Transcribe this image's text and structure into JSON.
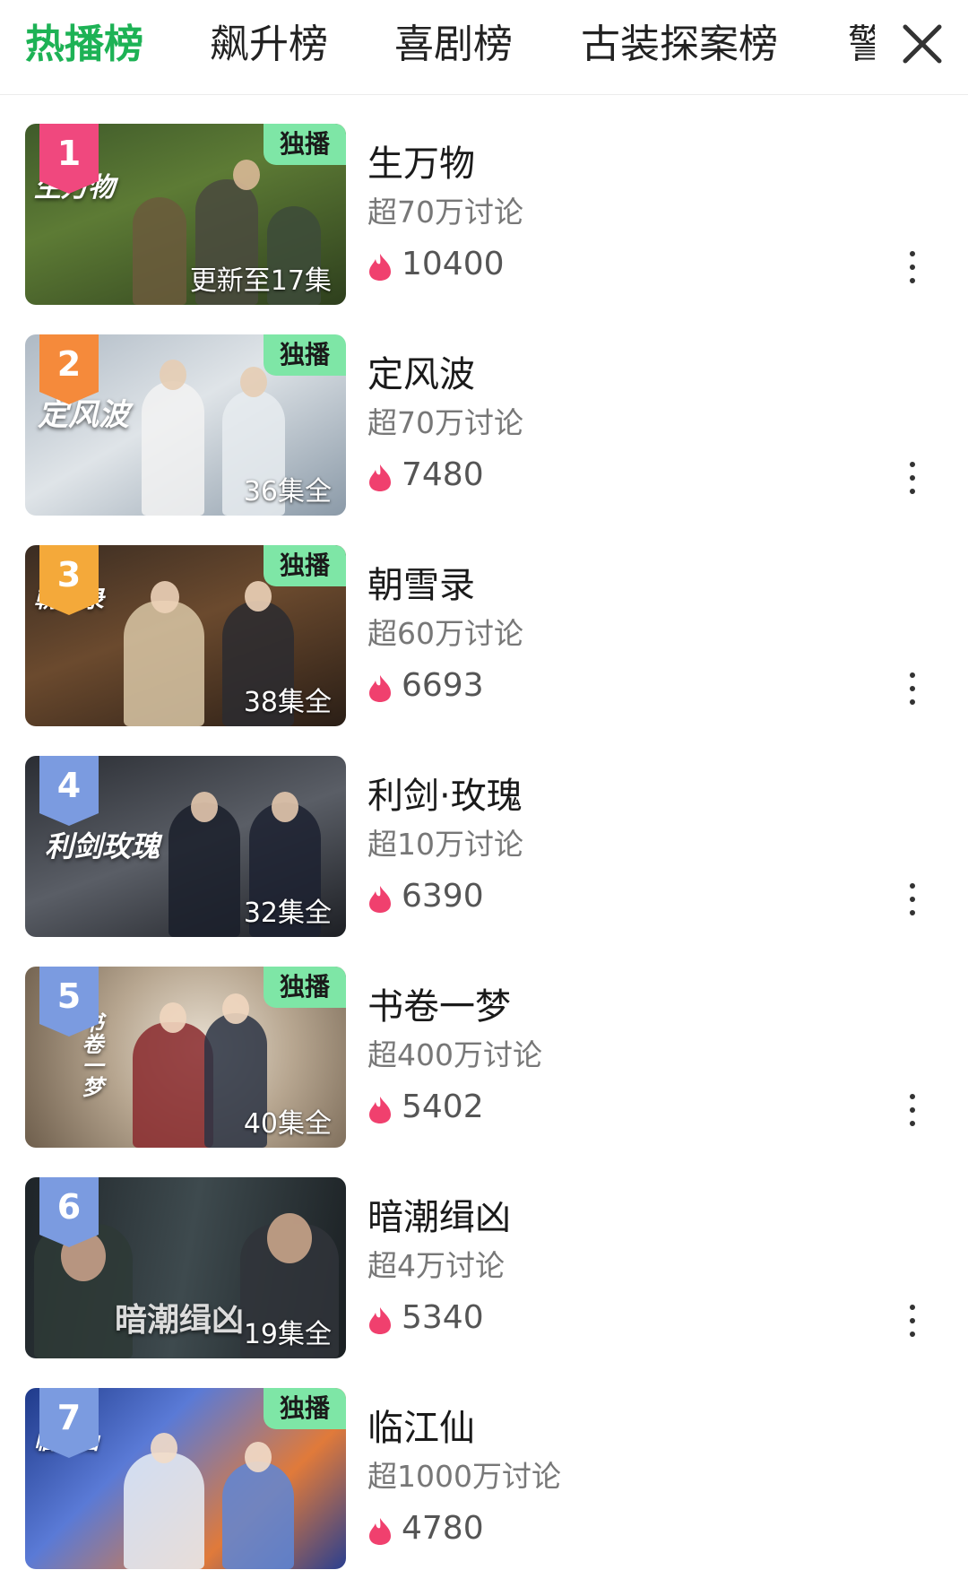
{
  "tabs": [
    {
      "label": "热播榜",
      "active": true
    },
    {
      "label": "飙升榜",
      "active": false
    },
    {
      "label": "喜剧榜",
      "active": false
    },
    {
      "label": "古装探案榜",
      "active": false
    },
    {
      "label": "警",
      "active": false
    }
  ],
  "close_icon": "close-icon",
  "colors": {
    "accent": "#1db255",
    "rank1": "#f0487e",
    "rank2": "#f58a3b",
    "rank3": "#f4a93a",
    "rank_other": "#7b9be0",
    "exclusive_bg": "#7ee6a6",
    "heat": "#f0406e"
  },
  "items": [
    {
      "rank": "1",
      "title": "生万物",
      "discussion": "超70万讨论",
      "heat": "10400",
      "exclusive": "独播",
      "episode": "更新至17集",
      "logo": "生万物"
    },
    {
      "rank": "2",
      "title": "定风波",
      "discussion": "超70万讨论",
      "heat": "7480",
      "exclusive": "独播",
      "episode": "36集全",
      "logo": "定风波"
    },
    {
      "rank": "3",
      "title": "朝雪录",
      "discussion": "超60万讨论",
      "heat": "6693",
      "exclusive": "独播",
      "episode": "38集全",
      "logo": "朝雪录"
    },
    {
      "rank": "4",
      "title": "利剑·玫瑰",
      "discussion": "超10万讨论",
      "heat": "6390",
      "exclusive": "",
      "episode": "32集全",
      "logo": "利剑玫瑰"
    },
    {
      "rank": "5",
      "title": "书卷一梦",
      "discussion": "超400万讨论",
      "heat": "5402",
      "exclusive": "独播",
      "episode": "40集全",
      "logo": "书卷一梦"
    },
    {
      "rank": "6",
      "title": "暗潮缉凶",
      "discussion": "超4万讨论",
      "heat": "5340",
      "exclusive": "",
      "episode": "19集全",
      "logo": "暗潮缉凶"
    },
    {
      "rank": "7",
      "title": "临江仙",
      "discussion": "超1000万讨论",
      "heat": "4780",
      "exclusive": "独播",
      "episode": "",
      "logo": "临江仙"
    }
  ]
}
